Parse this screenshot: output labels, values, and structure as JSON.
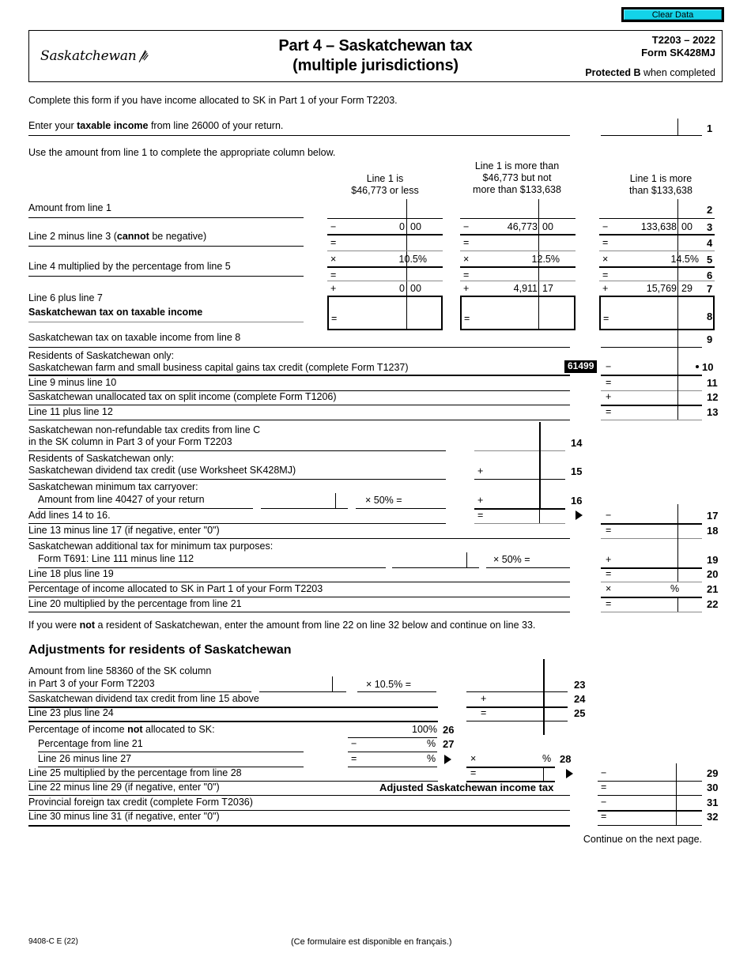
{
  "toolbar": {
    "clear_data": "Clear Data"
  },
  "header": {
    "logo_text": "Saskatchewan",
    "title_line1": "Part 4 – Saskatchewan tax",
    "title_line2": "(multiple jurisdictions)",
    "form_year": "T2203 – 2022",
    "form_code": "Form SK428MJ",
    "protected_bold": "Protected B",
    "protected_rest": " when completed"
  },
  "intro": {
    "complete_note": "Complete this form if you have income allocated to SK in Part 1 of your Form T2203.",
    "line1_pre": "Enter your ",
    "line1_bold": "taxable income",
    "line1_post": " from line 26000 of your return.",
    "line1_no": "1",
    "use_amount": "Use the amount from line 1 to complete the appropriate column below."
  },
  "columns": [
    {
      "head1": "Line 1 is",
      "head2": "$46,773 or less",
      "head3": ""
    },
    {
      "head1": "Line 1 is more than",
      "head2": "$46,773 but not",
      "head3": "more than $133,638"
    },
    {
      "head1": "Line 1 is more",
      "head2": "than $133,638",
      "head3": ""
    }
  ],
  "bracket_rows": [
    {
      "label": "Amount from line 1",
      "no": "2",
      "op": "",
      "values": [
        "",
        "",
        ""
      ],
      "cents": [
        "",
        "",
        ""
      ]
    },
    {
      "label": "",
      "no": "3",
      "op": "−",
      "values": [
        "0",
        "46,773",
        "133,638"
      ],
      "cents": [
        "00",
        "00",
        "00"
      ]
    },
    {
      "label": "Line 2 minus line 3 (cannot be negative)",
      "label_bold": "cannot",
      "no": "4",
      "op": "=",
      "values": [
        "",
        "",
        ""
      ],
      "cents": [
        "",
        "",
        ""
      ]
    },
    {
      "label": "",
      "no": "5",
      "op": "×",
      "values": [
        "10.5%",
        "12.5%",
        "14.5%"
      ],
      "cents": [
        "",
        "",
        ""
      ]
    },
    {
      "label": "Line 4 multiplied by the percentage from line 5",
      "no": "6",
      "op": "=",
      "values": [
        "",
        "",
        ""
      ],
      "cents": [
        "",
        "",
        ""
      ]
    },
    {
      "label": "",
      "no": "7",
      "op": "+",
      "values": [
        "0",
        "4,911",
        "15,769"
      ],
      "cents": [
        "00",
        "17",
        "29"
      ]
    },
    {
      "label": "Line 6 plus line 7",
      "label2": "Saskatchewan tax on taxable income",
      "no": "8",
      "op": "=",
      "values": [
        "",
        "",
        ""
      ],
      "cents": [
        "",
        "",
        ""
      ]
    }
  ],
  "rows": [
    {
      "no": "9",
      "label": "Saskatchewan tax on taxable income from line 8",
      "op": ""
    },
    {
      "no": "10",
      "label_a": "Residents of Saskatchewan only:",
      "label_b": "Saskatchewan farm and small business capital gains tax credit (complete Form T1237)",
      "code": "61499",
      "op": "−"
    },
    {
      "no": "11",
      "label": "Line 9 minus line 10",
      "op": "="
    },
    {
      "no": "12",
      "label": "Saskatchewan unallocated tax on split income (complete Form T1206)",
      "op": "+"
    },
    {
      "no": "13",
      "label": "Line 11 plus line 12",
      "op": "="
    },
    {
      "no": "14",
      "label_a": "Saskatchewan non-refundable tax credits from line C",
      "label_b": "in the SK column in Part 3 of your Form T2203",
      "op": ""
    },
    {
      "no": "15",
      "label_a": "Residents of Saskatchewan only:",
      "label_b": "Saskatchewan dividend tax credit (use Worksheet SK428MJ)",
      "op": "+"
    },
    {
      "no": "16",
      "label_a": "Saskatchewan minimum tax carryover:",
      "label_b": "Amount from line 40427 of your return",
      "mult": "×  50%  =",
      "op": "+"
    },
    {
      "no": "17",
      "label": "Add lines 14 to 16.",
      "op_mid": "=",
      "op": "−"
    },
    {
      "no": "18",
      "label": "Line 13 minus line 17 (if negative, enter \"0\")",
      "op": "="
    },
    {
      "no": "19",
      "label_a": "Saskatchewan additional tax for minimum tax purposes:",
      "label_b": "Form T691: Line 111 minus line 112",
      "mult": "×  50%  =",
      "op": "+"
    },
    {
      "no": "20",
      "label": "Line 18 plus line 19",
      "op": "="
    },
    {
      "no": "21",
      "label": "Percentage of income allocated to SK in Part 1 of your Form T2203",
      "op": "×",
      "pct": "%"
    },
    {
      "no": "22",
      "label": "Line 20 multiplied by the percentage from line 21",
      "op": "="
    }
  ],
  "note_nonresident": {
    "pre": "If you were ",
    "bold": "not",
    "post": " a resident of Saskatchewan, enter the amount from line 22 on line 32 below and continue on line 33."
  },
  "adjustments": {
    "heading": "Adjustments for residents of Saskatchewan",
    "rows": [
      {
        "no": "23",
        "label_a": "Amount from line 58360 of the SK column",
        "label_b": "in Part 3 of your Form T2203",
        "mult": "×  10.5%  =",
        "op": ""
      },
      {
        "no": "24",
        "label": "Saskatchewan dividend tax credit from line 15 above",
        "op": "+"
      },
      {
        "no": "25",
        "label": "Line 23 plus line 24",
        "op": "="
      },
      {
        "no": "26",
        "label": "Percentage of income not allocated to SK:",
        "label_bold": "not",
        "value": "100%"
      },
      {
        "no": "27",
        "label": "Percentage from line 21",
        "op": "−",
        "pct": "%"
      },
      {
        "no": "28",
        "label": "Line 26 minus line 27",
        "op": "=",
        "pct": "%",
        "op2": "×",
        "pct2": "%"
      },
      {
        "no": "29",
        "label": "Line 25 multiplied by the percentage from line 28",
        "op": "=",
        "op2": "−"
      },
      {
        "no": "30",
        "label": "Line 22 minus line 29 (if negative, enter \"0\")",
        "bold_center": "Adjusted Saskatchewan income tax",
        "op": "="
      },
      {
        "no": "31",
        "label": "Provincial foreign tax credit (complete Form T2036)",
        "op": "−"
      },
      {
        "no": "32",
        "label": "Line 30 minus line 31 (if negative, enter \"0\")",
        "op": "="
      }
    ]
  },
  "continue_note": "Continue on the next page.",
  "footer": {
    "code": "9408-C E (22)",
    "french": "(Ce formulaire est disponible en français.)"
  }
}
